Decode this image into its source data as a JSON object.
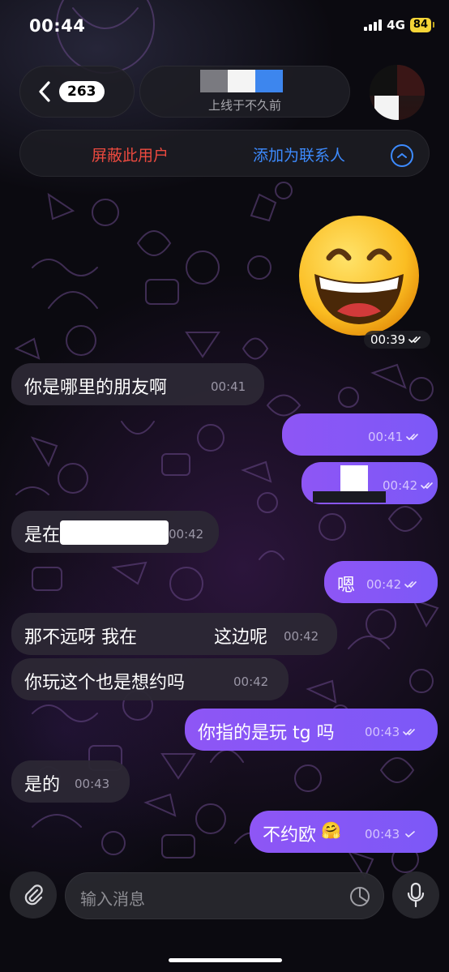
{
  "status": {
    "time": "00:44",
    "network": "4G",
    "battery": "84"
  },
  "header": {
    "unread_count": "263",
    "last_seen": "上线于不久前"
  },
  "actions": {
    "block": "屏蔽此用户",
    "add_contact": "添加为联系人"
  },
  "sticker": {
    "emoji": "grinning-face",
    "time": "00:39"
  },
  "messages": [
    {
      "dir": "in",
      "text": "你是哪里的朋友啊",
      "time": "00:41"
    },
    {
      "dir": "out",
      "text": "",
      "time": "00:41",
      "read": true
    },
    {
      "dir": "out",
      "text": "",
      "time": "00:42",
      "read": true
    },
    {
      "dir": "in",
      "text": "是在",
      "time": "00:42"
    },
    {
      "dir": "out",
      "text": "嗯",
      "time": "00:42",
      "read": true
    },
    {
      "dir": "in",
      "text": "那不远呀 我在",
      "text_end": "这边呢",
      "time": "00:42"
    },
    {
      "dir": "in",
      "text": "你玩这个也是想约吗",
      "time": "00:42"
    },
    {
      "dir": "out",
      "text": "你指的是玩 tg 吗",
      "time": "00:43",
      "read": true
    },
    {
      "dir": "in",
      "text": "是的",
      "time": "00:43"
    },
    {
      "dir": "out",
      "text": "不约欧",
      "emoji": "🤗",
      "time": "00:43",
      "read": false
    }
  ],
  "composer": {
    "placeholder": "输入消息"
  },
  "icons": {
    "back": "chevron-left-icon",
    "collapse": "chevron-up-icon",
    "attach": "paperclip-icon",
    "sticker": "sticker-icon",
    "mic": "microphone-icon",
    "read": "double-check-icon",
    "sent": "single-check-icon"
  },
  "colors": {
    "outgoing": "#8e56f5",
    "block": "#ec4a3f",
    "link": "#3d8bff",
    "battery": "#f5d437"
  }
}
